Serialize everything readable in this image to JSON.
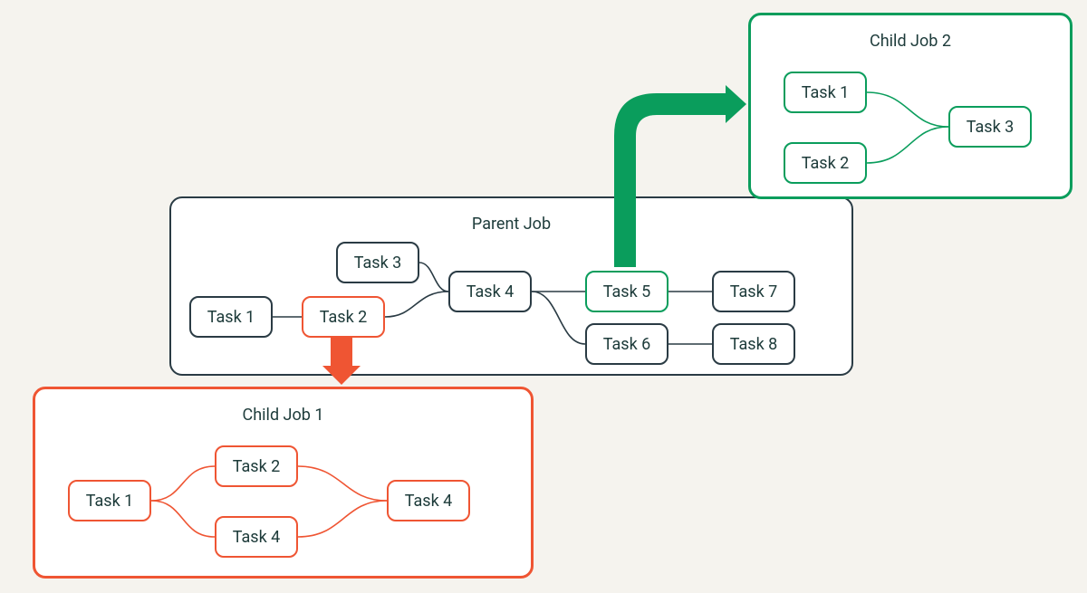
{
  "colors": {
    "background": "#f5f3ee",
    "dark": "#2a3b44",
    "red": "#ef5533",
    "green": "#0a9d5c"
  },
  "parent": {
    "title": "Parent Job",
    "tasks": {
      "t1": "Task 1",
      "t2": "Task 2",
      "t3": "Task 3",
      "t4": "Task 4",
      "t5": "Task 5",
      "t6": "Task 6",
      "t7": "Task 7",
      "t8": "Task 8"
    }
  },
  "child1": {
    "title": "Child Job 1",
    "tasks": {
      "t1": "Task 1",
      "t2": "Task 2",
      "t3": "Task 4",
      "t4": "Task 4"
    }
  },
  "child2": {
    "title": "Child Job 2",
    "tasks": {
      "t1": "Task 1",
      "t2": "Task 2",
      "t3": "Task 3"
    }
  },
  "diagram": {
    "description": "A parent job with 8 tasks spawns two child jobs. Task 2 (red) launches Child Job 1 (red). Task 5 (green) launches Child Job 2 (green).",
    "parent_edges": [
      [
        "Task 1",
        "Task 2"
      ],
      [
        "Task 2",
        "Task 4"
      ],
      [
        "Task 3",
        "Task 4"
      ],
      [
        "Task 4",
        "Task 5"
      ],
      [
        "Task 4",
        "Task 6"
      ],
      [
        "Task 5",
        "Task 7"
      ],
      [
        "Task 6",
        "Task 8"
      ]
    ],
    "child1_edges": [
      [
        "Task 1",
        "Task 2"
      ],
      [
        "Task 1",
        "Task 4"
      ],
      [
        "Task 2",
        "Task 4"
      ],
      [
        "Task 4",
        "Task 4"
      ]
    ],
    "child2_edges": [
      [
        "Task 1",
        "Task 3"
      ],
      [
        "Task 2",
        "Task 3"
      ]
    ],
    "spawn_arrows": [
      {
        "from": "Parent.Task 2",
        "to": "Child Job 1",
        "color": "red"
      },
      {
        "from": "Parent.Task 5",
        "to": "Child Job 2",
        "color": "green"
      }
    ]
  }
}
